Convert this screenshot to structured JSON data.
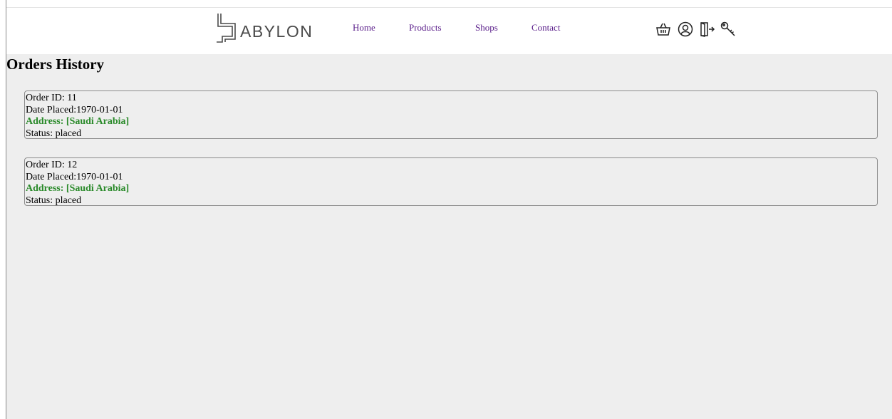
{
  "brand": {
    "name": "ABYLON",
    "logo_icon": "babylon-logo-icon"
  },
  "nav": {
    "items": [
      {
        "label": "Home"
      },
      {
        "label": "Products"
      },
      {
        "label": "Shops"
      },
      {
        "label": "Contact"
      }
    ],
    "link_color": "#5a1e8a"
  },
  "header_icons": [
    "basket-icon",
    "user-icon",
    "logout-icon",
    "key-icon"
  ],
  "page": {
    "title": "Orders History",
    "background": "#eeeeee"
  },
  "orders": [
    {
      "id_label": "Order ID: 11",
      "date_label": "Date Placed:1970-01-01",
      "address_label": "Address: [Saudi Arabia]",
      "status_label": "Status: placed"
    },
    {
      "id_label": "Order ID: 12",
      "date_label": "Date Placed:1970-01-01",
      "address_label": "Address: [Saudi Arabia]",
      "status_label": "Status: placed"
    }
  ],
  "colors": {
    "address": "#2a8a2a",
    "logo": "#4a4a4a"
  }
}
